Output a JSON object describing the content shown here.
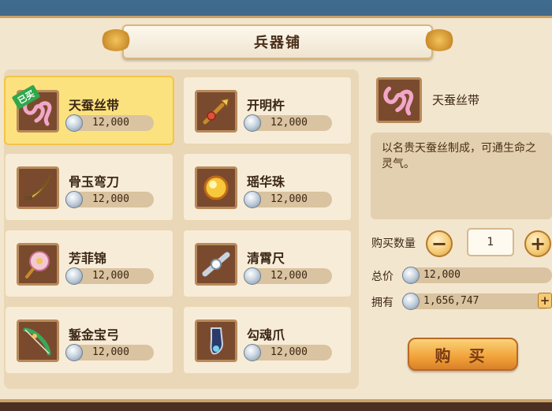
{
  "window": {
    "title": "兵器铺"
  },
  "items": [
    {
      "name": "天蚕丝带",
      "price": "12,000",
      "tag": "已买",
      "icon": "silk-ribbon-icon",
      "selected": true
    },
    {
      "name": "开明杵",
      "price": "12,000",
      "icon": "pestle-icon"
    },
    {
      "name": "骨玉弯刀",
      "price": "12,000",
      "icon": "curved-blade-icon"
    },
    {
      "name": "瑶华珠",
      "price": "12,000",
      "icon": "orb-icon"
    },
    {
      "name": "芳菲锦",
      "price": "12,000",
      "icon": "flower-fan-icon"
    },
    {
      "name": "清霄尺",
      "price": "12,000",
      "icon": "ruler-icon"
    },
    {
      "name": "錾金宝弓",
      "price": "12,000",
      "icon": "bow-icon"
    },
    {
      "name": "勾魂爪",
      "price": "12,000",
      "icon": "claw-icon"
    }
  ],
  "detail": {
    "name": "天蚕丝带",
    "description": "以名贵天蚕丝制成，可通生命之灵气。",
    "quantity_label": "购买数量",
    "quantity": "1",
    "minus": "−",
    "plus": "+",
    "total_label": "总价",
    "total": "12,000",
    "owned_label": "拥有",
    "owned": "1,656,747",
    "buy_label": "购 买"
  },
  "colors": {
    "selected_card": "#fbe27f",
    "panel": "#f3e6cf",
    "buy_button": "#f0a238"
  }
}
